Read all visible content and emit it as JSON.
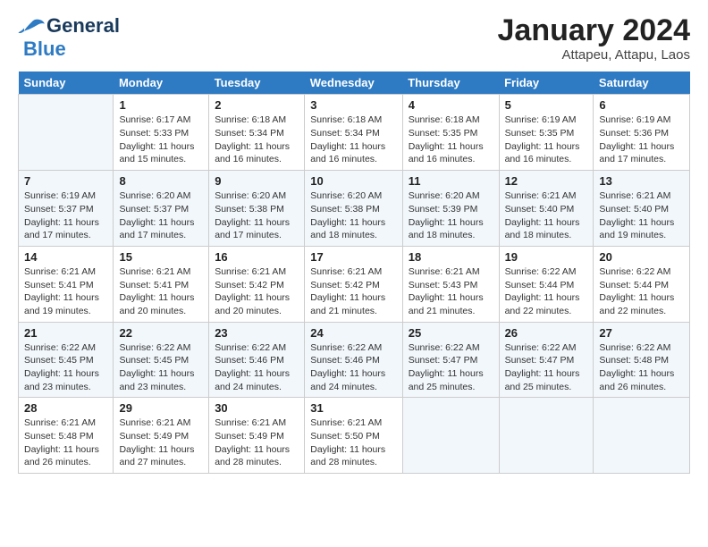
{
  "header": {
    "logo_line1": "General",
    "logo_line2": "Blue",
    "calendar_title": "January 2024",
    "calendar_subtitle": "Attapeu, Attapu, Laos"
  },
  "weekdays": [
    "Sunday",
    "Monday",
    "Tuesday",
    "Wednesday",
    "Thursday",
    "Friday",
    "Saturday"
  ],
  "weeks": [
    [
      {
        "day": "",
        "info": ""
      },
      {
        "day": "1",
        "info": "Sunrise: 6:17 AM\nSunset: 5:33 PM\nDaylight: 11 hours\nand 15 minutes."
      },
      {
        "day": "2",
        "info": "Sunrise: 6:18 AM\nSunset: 5:34 PM\nDaylight: 11 hours\nand 16 minutes."
      },
      {
        "day": "3",
        "info": "Sunrise: 6:18 AM\nSunset: 5:34 PM\nDaylight: 11 hours\nand 16 minutes."
      },
      {
        "day": "4",
        "info": "Sunrise: 6:18 AM\nSunset: 5:35 PM\nDaylight: 11 hours\nand 16 minutes."
      },
      {
        "day": "5",
        "info": "Sunrise: 6:19 AM\nSunset: 5:35 PM\nDaylight: 11 hours\nand 16 minutes."
      },
      {
        "day": "6",
        "info": "Sunrise: 6:19 AM\nSunset: 5:36 PM\nDaylight: 11 hours\nand 17 minutes."
      }
    ],
    [
      {
        "day": "7",
        "info": "Sunrise: 6:19 AM\nSunset: 5:37 PM\nDaylight: 11 hours\nand 17 minutes."
      },
      {
        "day": "8",
        "info": "Sunrise: 6:20 AM\nSunset: 5:37 PM\nDaylight: 11 hours\nand 17 minutes."
      },
      {
        "day": "9",
        "info": "Sunrise: 6:20 AM\nSunset: 5:38 PM\nDaylight: 11 hours\nand 17 minutes."
      },
      {
        "day": "10",
        "info": "Sunrise: 6:20 AM\nSunset: 5:38 PM\nDaylight: 11 hours\nand 18 minutes."
      },
      {
        "day": "11",
        "info": "Sunrise: 6:20 AM\nSunset: 5:39 PM\nDaylight: 11 hours\nand 18 minutes."
      },
      {
        "day": "12",
        "info": "Sunrise: 6:21 AM\nSunset: 5:40 PM\nDaylight: 11 hours\nand 18 minutes."
      },
      {
        "day": "13",
        "info": "Sunrise: 6:21 AM\nSunset: 5:40 PM\nDaylight: 11 hours\nand 19 minutes."
      }
    ],
    [
      {
        "day": "14",
        "info": "Sunrise: 6:21 AM\nSunset: 5:41 PM\nDaylight: 11 hours\nand 19 minutes."
      },
      {
        "day": "15",
        "info": "Sunrise: 6:21 AM\nSunset: 5:41 PM\nDaylight: 11 hours\nand 20 minutes."
      },
      {
        "day": "16",
        "info": "Sunrise: 6:21 AM\nSunset: 5:42 PM\nDaylight: 11 hours\nand 20 minutes."
      },
      {
        "day": "17",
        "info": "Sunrise: 6:21 AM\nSunset: 5:42 PM\nDaylight: 11 hours\nand 21 minutes."
      },
      {
        "day": "18",
        "info": "Sunrise: 6:21 AM\nSunset: 5:43 PM\nDaylight: 11 hours\nand 21 minutes."
      },
      {
        "day": "19",
        "info": "Sunrise: 6:22 AM\nSunset: 5:44 PM\nDaylight: 11 hours\nand 22 minutes."
      },
      {
        "day": "20",
        "info": "Sunrise: 6:22 AM\nSunset: 5:44 PM\nDaylight: 11 hours\nand 22 minutes."
      }
    ],
    [
      {
        "day": "21",
        "info": "Sunrise: 6:22 AM\nSunset: 5:45 PM\nDaylight: 11 hours\nand 23 minutes."
      },
      {
        "day": "22",
        "info": "Sunrise: 6:22 AM\nSunset: 5:45 PM\nDaylight: 11 hours\nand 23 minutes."
      },
      {
        "day": "23",
        "info": "Sunrise: 6:22 AM\nSunset: 5:46 PM\nDaylight: 11 hours\nand 24 minutes."
      },
      {
        "day": "24",
        "info": "Sunrise: 6:22 AM\nSunset: 5:46 PM\nDaylight: 11 hours\nand 24 minutes."
      },
      {
        "day": "25",
        "info": "Sunrise: 6:22 AM\nSunset: 5:47 PM\nDaylight: 11 hours\nand 25 minutes."
      },
      {
        "day": "26",
        "info": "Sunrise: 6:22 AM\nSunset: 5:47 PM\nDaylight: 11 hours\nand 25 minutes."
      },
      {
        "day": "27",
        "info": "Sunrise: 6:22 AM\nSunset: 5:48 PM\nDaylight: 11 hours\nand 26 minutes."
      }
    ],
    [
      {
        "day": "28",
        "info": "Sunrise: 6:21 AM\nSunset: 5:48 PM\nDaylight: 11 hours\nand 26 minutes."
      },
      {
        "day": "29",
        "info": "Sunrise: 6:21 AM\nSunset: 5:49 PM\nDaylight: 11 hours\nand 27 minutes."
      },
      {
        "day": "30",
        "info": "Sunrise: 6:21 AM\nSunset: 5:49 PM\nDaylight: 11 hours\nand 28 minutes."
      },
      {
        "day": "31",
        "info": "Sunrise: 6:21 AM\nSunset: 5:50 PM\nDaylight: 11 hours\nand 28 minutes."
      },
      {
        "day": "",
        "info": ""
      },
      {
        "day": "",
        "info": ""
      },
      {
        "day": "",
        "info": ""
      }
    ]
  ]
}
